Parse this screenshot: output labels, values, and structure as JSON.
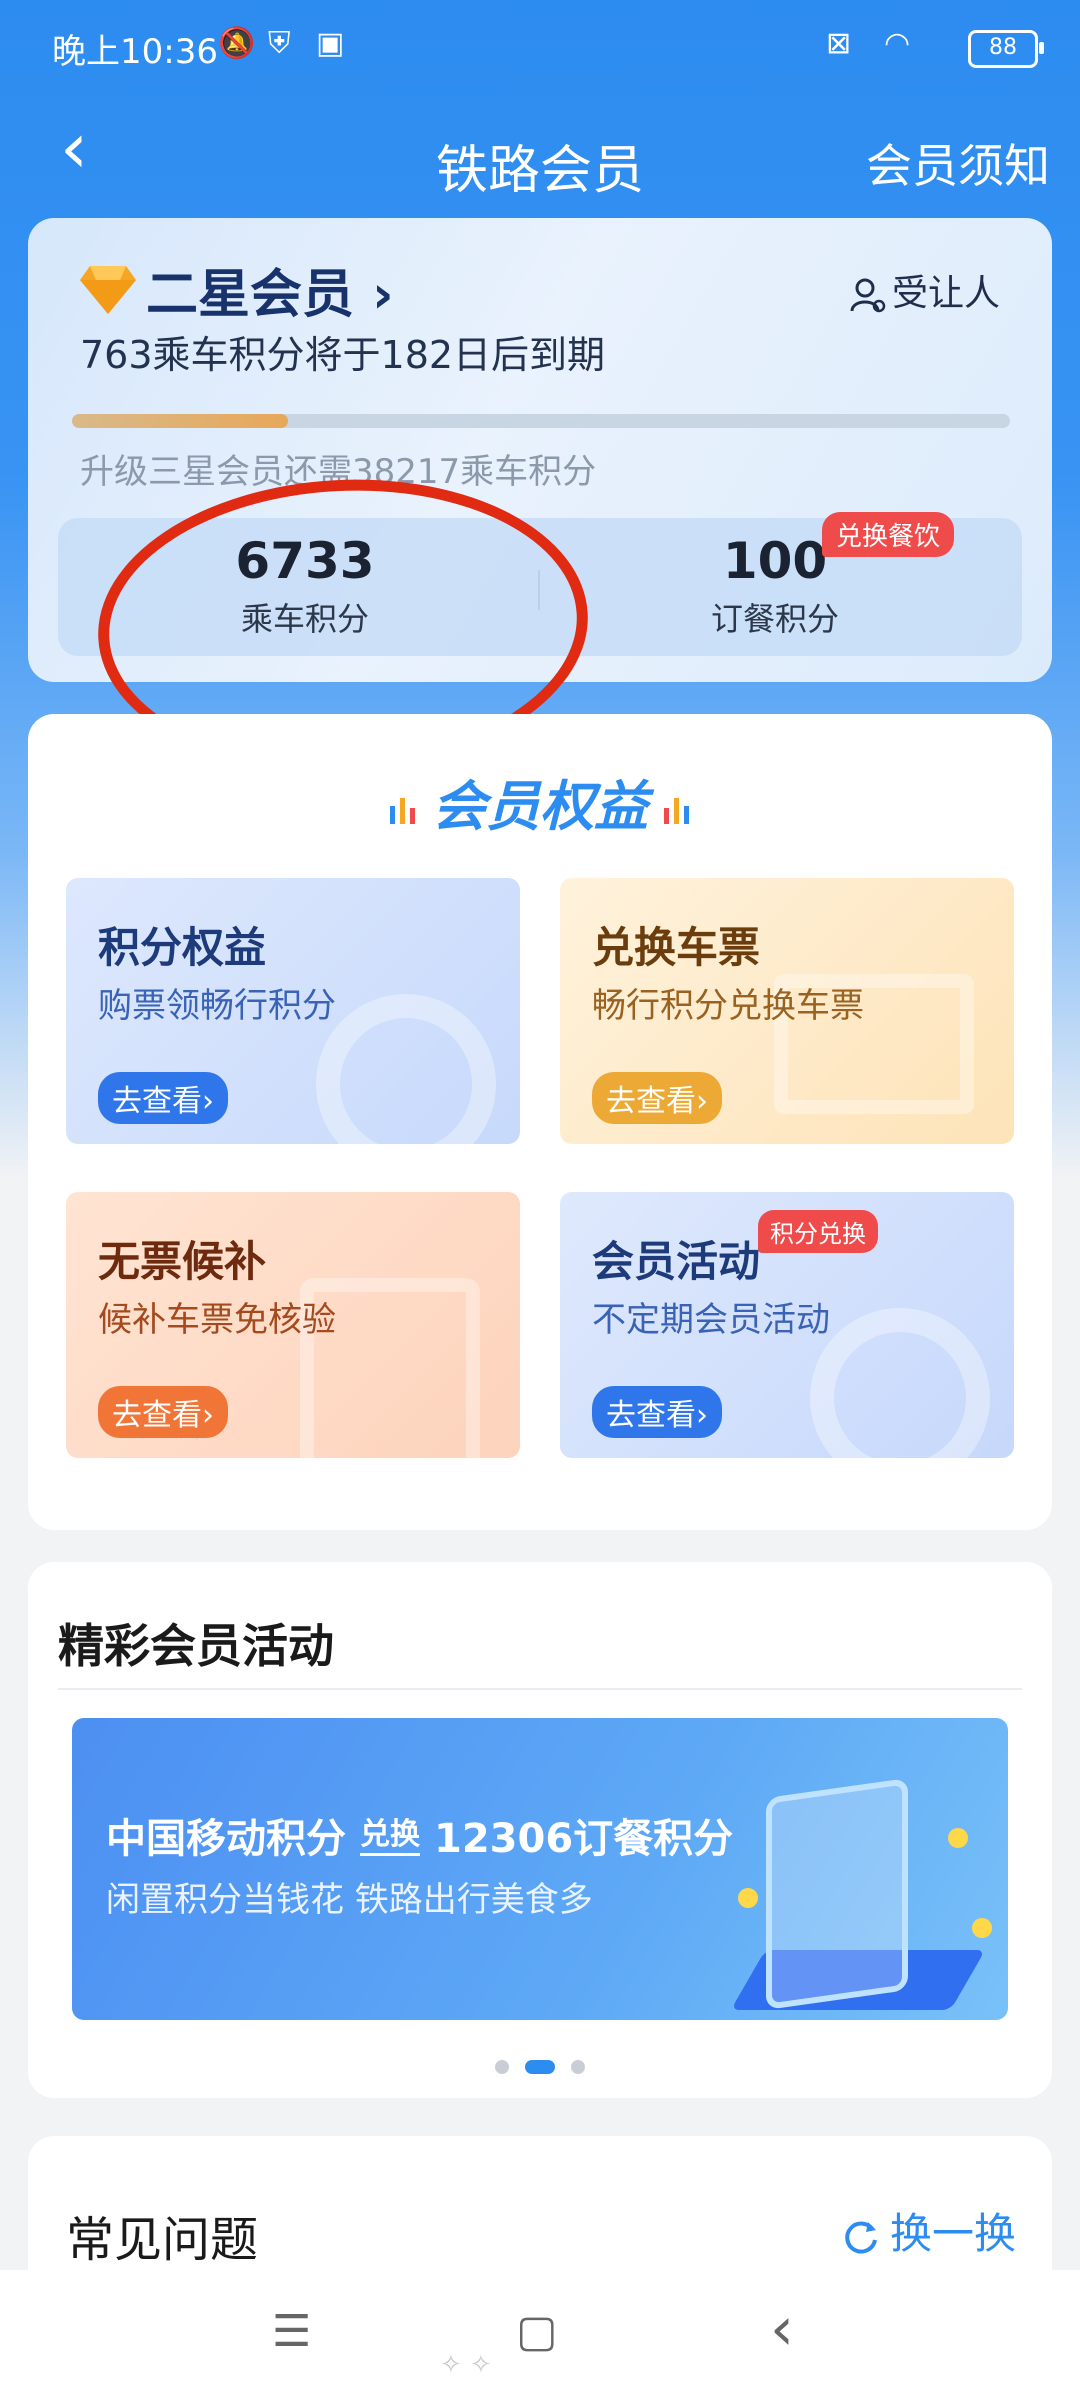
{
  "status_bar": {
    "time": "晚上10:36",
    "battery": "88",
    "icons": [
      "bell-muted-icon",
      "shield-icon",
      "app-icon",
      "sim-off-icon",
      "wifi-icon",
      "battery-icon"
    ]
  },
  "nav": {
    "title": "铁路会员",
    "back_icon": "back-arrow-icon",
    "right_link": "会员须知"
  },
  "member_card": {
    "level": "二星会员",
    "level_arrow": "›",
    "assignee": "受让人",
    "expire_text": "763乘车积分将于182日后到期",
    "progress_fraction": 0.23,
    "upgrade_text": "升级三星会员还需38217乘车积分",
    "ride_points": {
      "value": "6733",
      "label": "乘车积分"
    },
    "meal_points": {
      "value": "100",
      "label": "订餐积分",
      "tag": "兑换餐饮"
    }
  },
  "benefits": {
    "title": "会员权益",
    "tiles": [
      {
        "title": "积分权益",
        "subtitle": "购票领畅行积分",
        "button": "去查看›",
        "accent": "#2f76ea"
      },
      {
        "title": "兑换车票",
        "subtitle": "畅行积分兑换车票",
        "button": "去查看›",
        "accent": "#eda936"
      },
      {
        "title": "无票候补",
        "subtitle": "候补车票免核验",
        "button": "去查看›",
        "accent": "#f27538"
      },
      {
        "title": "会员活动",
        "subtitle": "不定期会员活动",
        "button": "去查看›",
        "badge": "积分兑换",
        "accent": "#2f76ea"
      }
    ]
  },
  "activity": {
    "title": "精彩会员活动",
    "banner": {
      "line1_left": "中国移动积分",
      "line1_exchange": "兑换",
      "line1_right": "12306订餐积分",
      "line2": "闲置积分当钱花  铁路出行美食多"
    },
    "pager_active": 1
  },
  "faq": {
    "title": "常见问题",
    "refresh": "换一换"
  },
  "system_nav": {
    "menu": "☰",
    "home": "▢",
    "back": "‹"
  },
  "colors": {
    "primary": "#2d8cf0",
    "annotation": "#e02a12",
    "tag_red": "#ef4b4b"
  }
}
